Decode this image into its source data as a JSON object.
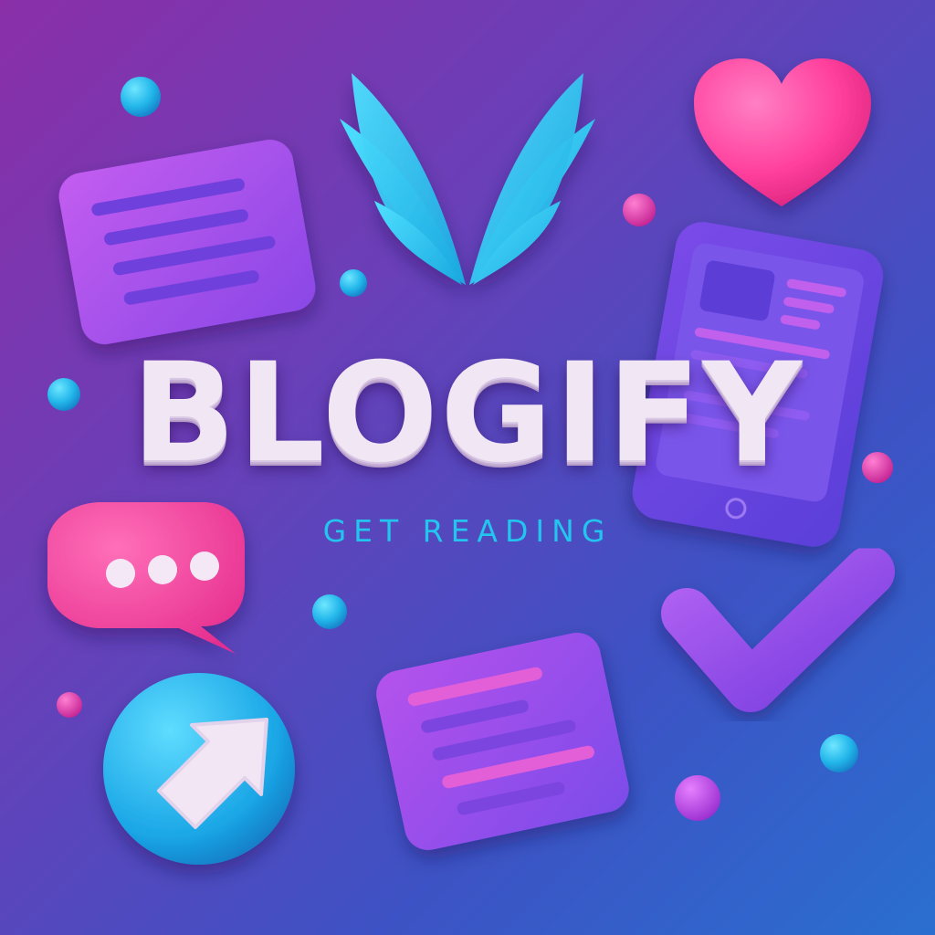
{
  "brand": {
    "name": "BLOGIFY",
    "tagline": "GET READING"
  },
  "icons": [
    "leaf-wings-logo-icon",
    "heart-icon",
    "document-card-icon",
    "tablet-article-icon",
    "chat-bubble-icon",
    "arrow-circle-icon",
    "document-card-icon",
    "checkmark-icon"
  ],
  "colors": {
    "background_start": "#8a2fa8",
    "background_end": "#2a6fd0",
    "accent_cyan": "#23c4ee",
    "accent_pink": "#ff3d9a",
    "accent_purple": "#8e4ff0",
    "title_text": "#f1e6f4"
  }
}
